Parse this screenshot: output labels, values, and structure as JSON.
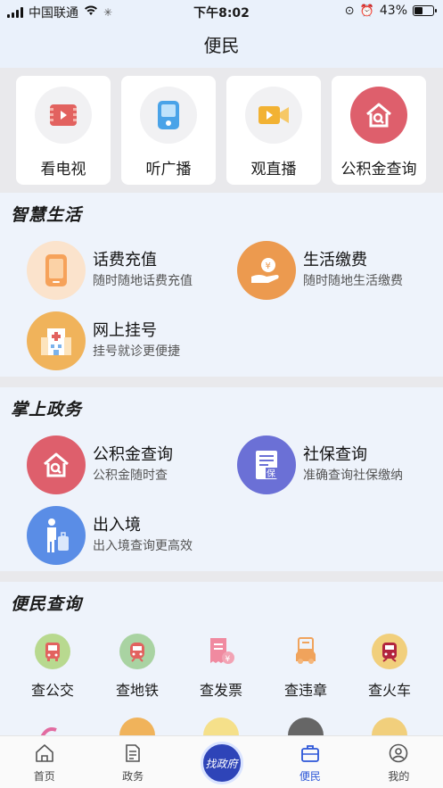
{
  "status_bar": {
    "carrier": "中国联通",
    "time": "下午8:02",
    "battery": "43%",
    "battery_level": 0.43
  },
  "header": {
    "title": "便民"
  },
  "top_tiles": [
    {
      "label": "看电视",
      "icon": "tv-icon",
      "color": "#e2625f"
    },
    {
      "label": "听广播",
      "icon": "radio-icon",
      "color": "#4aa3e8"
    },
    {
      "label": "观直播",
      "icon": "live-video-icon",
      "color": "#f2b233"
    },
    {
      "label": "公积金查询",
      "icon": "house-search-icon",
      "color": "#de5f6c"
    }
  ],
  "smart_life": {
    "title": "智慧生活",
    "items": [
      {
        "name": "话费充值",
        "desc": "随时随地话费充值",
        "icon": "phone-icon",
        "color": "#f6a25a"
      },
      {
        "name": "生活缴费",
        "desc": "随时随地生活缴费",
        "icon": "bill-hand-icon",
        "color": "#ec9a4f"
      },
      {
        "name": "网上挂号",
        "desc": "挂号就诊更便捷",
        "icon": "hospital-icon",
        "color": "#f0b35b"
      }
    ]
  },
  "gov_affairs": {
    "title": "掌上政务",
    "items": [
      {
        "name": "公积金查询",
        "desc": "公积金随时查",
        "icon": "house-search-icon",
        "color": "#de5f6c"
      },
      {
        "name": "社保查询",
        "desc": "准确查询社保缴纳",
        "icon": "insurance-doc-icon",
        "color": "#6b70d6"
      },
      {
        "name": "出入境",
        "desc": "出入境查询更高效",
        "icon": "traveler-icon",
        "color": "#5a8de6"
      }
    ]
  },
  "convenience_query": {
    "title": "便民查询",
    "items": [
      {
        "label": "查公交",
        "icon": "bus-icon",
        "color": "#b8d98f"
      },
      {
        "label": "查地铁",
        "icon": "subway-icon",
        "color": "#a9d3a2"
      },
      {
        "label": "查发票",
        "icon": "invoice-icon",
        "color": "#f2a3b4"
      },
      {
        "label": "查违章",
        "icon": "car-violation-icon",
        "color": "#f5b67a"
      },
      {
        "label": "查火车",
        "icon": "train-icon",
        "color": "#f1cf7c"
      }
    ]
  },
  "tab_bar": {
    "items": [
      {
        "label": "首页",
        "icon": "home-icon"
      },
      {
        "label": "政务",
        "icon": "gov-doc-icon"
      },
      {
        "label": "找政府",
        "icon": "find-gov-icon"
      },
      {
        "label": "便民",
        "icon": "briefcase-icon",
        "active": true
      },
      {
        "label": "我的",
        "icon": "user-icon"
      }
    ]
  }
}
